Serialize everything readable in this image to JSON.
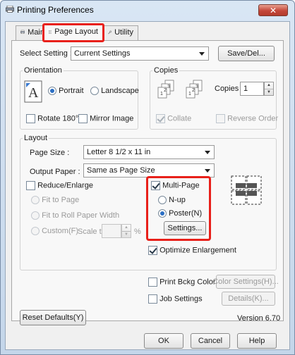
{
  "window": {
    "title": "Printing Preferences",
    "close_glyph": "✕"
  },
  "tabs": [
    {
      "label": "Main",
      "icon": "printer-icon"
    },
    {
      "label": "Page Layout",
      "icon": "page-icon"
    },
    {
      "label": "Utility",
      "icon": "wrench-icon"
    }
  ],
  "select_setting": {
    "label": "Select Setting :",
    "value": "Current Settings",
    "save_button": "Save/Del..."
  },
  "orientation": {
    "legend": "Orientation",
    "portrait": "Portrait",
    "landscape": "Landscape",
    "selected": "Portrait"
  },
  "copies": {
    "legend": "Copies",
    "label": "Copies :",
    "value": "1",
    "collate": "Collate",
    "reverse_order": "Reverse Order"
  },
  "rotate": {
    "rotate180": "Rotate 180°",
    "mirror": "Mirror Image"
  },
  "layout": {
    "legend": "Layout",
    "page_size_label": "Page Size :",
    "page_size_value": "Letter 8 1/2 x 11 in",
    "output_paper_label": "Output Paper :",
    "output_paper_value": "Same as Page Size",
    "reduce_enlarge": "Reduce/Enlarge",
    "fit_to_page": "Fit to Page",
    "fit_to_roll": "Fit to Roll Paper Width",
    "custom": "Custom(F)",
    "scale_to": "Scale to",
    "percent": "%",
    "multi_page": "Multi-Page",
    "n_up": "N-up",
    "poster": "Poster(N)",
    "settings_button": "Settings..."
  },
  "optimize_enlargement": "Optimize Enlargement",
  "print_bckg_color": "Print Bckg Color",
  "color_settings_button": "Color Settings(H)...",
  "job_settings": "Job Settings",
  "details_button": "Details(K)...",
  "reset_defaults": "Reset Defaults(Y)",
  "version": "Version 6.70",
  "dialog_buttons": {
    "ok": "OK",
    "cancel": "Cancel",
    "help": "Help"
  },
  "colors": {
    "highlight": "#e8201a",
    "radio_selected": "#2b6fc4"
  }
}
